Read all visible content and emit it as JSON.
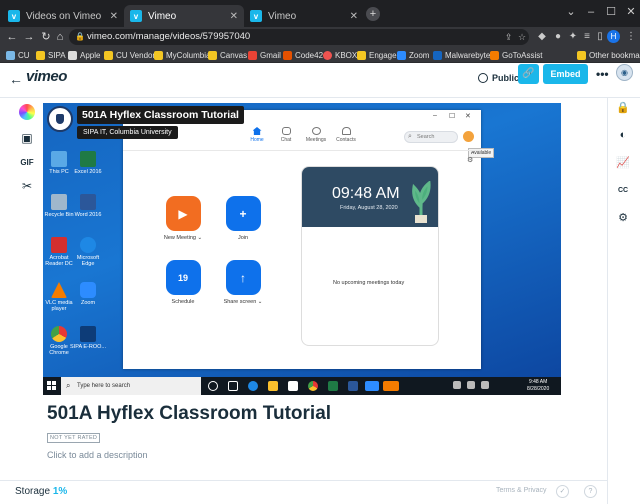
{
  "browser": {
    "tabs": [
      {
        "label": "Videos on Vimeo",
        "active": false
      },
      {
        "label": "Vimeo",
        "active": true
      },
      {
        "label": "Vimeo",
        "active": false
      }
    ],
    "url": "vimeo.com/manage/videos/579957040",
    "profile_initial": "H",
    "bookmarks": [
      "CU",
      "SIPA",
      "Apple",
      "CU Vendors",
      "MyColumbia",
      "Canvas",
      "Gmail",
      "Code42",
      "KBOX",
      "Engage",
      "Zoom",
      "Malwarebytes",
      "GoToAssist"
    ],
    "other_bookmarks": "Other bookmarks"
  },
  "header": {
    "logo": "vimeo",
    "privacy_label": "Public",
    "embed_label": "Embed"
  },
  "left_tools": {
    "gif_label": "GIF"
  },
  "video": {
    "overlay_title": "501A Hyflex Classroom Tutorial",
    "overlay_subtitle": "SIPA IT, Columbia University",
    "desktop_icons": [
      {
        "label": "This PC",
        "color": "#5aa9e6"
      },
      {
        "label": "Excel 2016",
        "color": "#1f7a45"
      },
      {
        "label": "Recycle Bin",
        "color": "#9fb7cc"
      },
      {
        "label": "Word 2016",
        "color": "#2b579a"
      },
      {
        "label": "Acrobat Reader DC",
        "color": "#d32f2f"
      },
      {
        "label": "Microsoft Edge",
        "color": "#1e88e5"
      },
      {
        "label": "VLC media player",
        "color": "#f57c00"
      },
      {
        "label": "Zoom",
        "color": "#2d8cff"
      },
      {
        "label": "Google Chrome",
        "color": "#e53935"
      },
      {
        "label": "SIPA E-ROO...",
        "color": "#0d3c78"
      }
    ],
    "zoom": {
      "nav": [
        "Home",
        "Chat",
        "Meetings",
        "Contacts"
      ],
      "search_placeholder": "Search",
      "available_tooltip": "Available",
      "buttons": [
        {
          "label": "New Meeting ⌄",
          "color": "#f26d21",
          "glyph": "▶"
        },
        {
          "label": "Join",
          "color": "#0e71eb",
          "glyph": "+"
        },
        {
          "label": "Schedule",
          "color": "#0e71eb",
          "glyph": "19"
        },
        {
          "label": "Share screen ⌄",
          "color": "#0e71eb",
          "glyph": "↑"
        }
      ],
      "time": "09:48 AM",
      "date": "Friday, August 28, 2020",
      "no_meetings": "No upcoming meetings today"
    },
    "taskbar": {
      "search_placeholder": "Type here to search",
      "clock_time": "9:48 AM",
      "clock_date": "8/28/2020"
    }
  },
  "page": {
    "title": "501A Hyflex Classroom Tutorial",
    "rating": "NOT YET RATED",
    "description_placeholder": "Click to add a description"
  },
  "footer": {
    "storage_label": "Storage",
    "storage_value": "1%",
    "terms": "Terms & Privacy"
  }
}
